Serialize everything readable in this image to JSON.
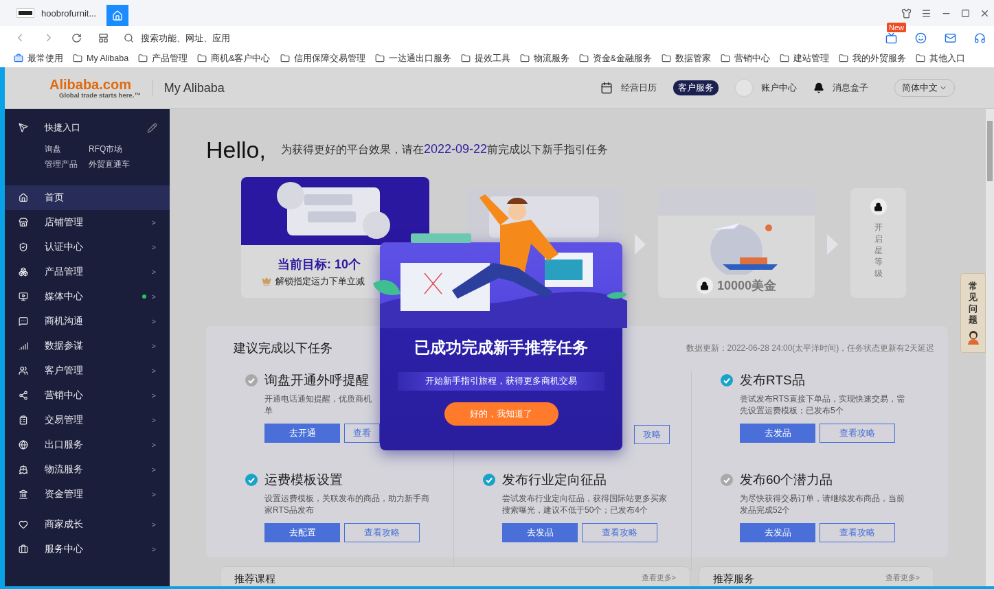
{
  "browser": {
    "tab_title": "hoobrofurnit...",
    "address_placeholder": "搜索功能、网址、应用",
    "badge": "New",
    "bookmarks": [
      {
        "label": "最常使用",
        "kind": "pinned"
      },
      {
        "label": "My Alibaba",
        "kind": "folder"
      },
      {
        "label": "产品管理",
        "kind": "folder"
      },
      {
        "label": "商机&客户中心",
        "kind": "folder"
      },
      {
        "label": "信用保障交易管理",
        "kind": "folder"
      },
      {
        "label": "一达通出口服务",
        "kind": "folder"
      },
      {
        "label": "提效工具",
        "kind": "folder"
      },
      {
        "label": "物流服务",
        "kind": "folder"
      },
      {
        "label": "资金&金融服务",
        "kind": "folder"
      },
      {
        "label": "数据管家",
        "kind": "folder"
      },
      {
        "label": "营销中心",
        "kind": "folder"
      },
      {
        "label": "建站管理",
        "kind": "folder"
      },
      {
        "label": "我的外贸服务",
        "kind": "folder"
      },
      {
        "label": "其他入口",
        "kind": "folder"
      }
    ]
  },
  "header": {
    "logo_text": "Alibaba.com",
    "logo_tagline": "Global trade starts here.™",
    "title": "My Alibaba",
    "nav": [
      {
        "label": "经营日历",
        "kind": "calendar"
      },
      {
        "label": "客户服务",
        "kind": "pill"
      },
      {
        "label": "账户中心",
        "kind": "avatar"
      },
      {
        "label": "消息盒子",
        "kind": "bell"
      }
    ],
    "language": "简体中文"
  },
  "sidebar": {
    "quick": {
      "title": "快捷入口",
      "links": [
        "询盘",
        "RFQ市场",
        "管理产品",
        "外贸直通车"
      ]
    },
    "menu_groups": [
      [
        {
          "label": "首页",
          "selected": true
        },
        {
          "label": "店铺管理",
          "selected": false,
          "chevron": ">"
        },
        {
          "label": "认证中心",
          "selected": false,
          "chevron": ">"
        },
        {
          "label": "产品管理",
          "selected": false,
          "chevron": ">"
        },
        {
          "label": "媒体中心",
          "selected": false,
          "chevron": ">",
          "color": "#22c55e"
        },
        {
          "label": "商机沟通",
          "selected": false,
          "chevron": ">"
        },
        {
          "label": "数据参谋",
          "selected": false,
          "chevron": ">"
        },
        {
          "label": "客户管理",
          "selected": false,
          "chevron": ">"
        },
        {
          "label": "营销中心",
          "selected": false,
          "chevron": ">"
        },
        {
          "label": "交易管理",
          "selected": false,
          "chevron": ">"
        },
        {
          "label": "出口服务",
          "selected": false,
          "chevron": ">"
        },
        {
          "label": "物流服务",
          "selected": false,
          "chevron": ">"
        },
        {
          "label": "资金管理",
          "selected": false,
          "chevron": ">"
        }
      ],
      [
        {
          "label": "商家成长",
          "selected": false,
          "chevron": ">"
        },
        {
          "label": "服务中心",
          "selected": false,
          "chevron": ">"
        }
      ]
    ]
  },
  "main": {
    "hello": "Hello,",
    "intro_before": "为获得更好的平台效果，请在",
    "intro_date": "2022-09-22",
    "intro_after": "前完成以下新手指引任务",
    "milestones": [
      {
        "kind": "chat",
        "title": "当前目标: 10个",
        "subtitle": "解锁指定运力下单立减",
        "selected": true
      },
      {
        "kind": "chart",
        "selected": false
      },
      {
        "kind": "shipping",
        "title": "10000美金",
        "selected": false,
        "locked": true
      },
      {
        "kind": "star",
        "title": "开启星等级",
        "selected": false,
        "locked": true
      }
    ],
    "tasks": {
      "title": "建议完成以下任务",
      "update_note": "数据更新：2022-06-28 24:00(太平洋时间)，任务状态更新有2天延迟",
      "items": [
        {
          "kind": "partial",
          "title": "询盘开通外呼提醒",
          "done": false,
          "description": "开通电话通知提醒，优质商机",
          "description_tail": "单",
          "primary": "去开通",
          "secondary": "查看"
        },
        {
          "kind": "covered",
          "secondary": "攻略"
        },
        {
          "kind": "task",
          "title": "发布RTS品",
          "done": true,
          "description": "尝试发布RTS直接下单品，实现快速交易，需先设置运费模板；已发布5个",
          "primary": "去发品",
          "secondary": "查看攻略"
        },
        {
          "kind": "task",
          "title": "运费模板设置",
          "done": true,
          "description": "设置运费模板，关联发布的商品，助力新手商家RTS品发布",
          "primary": "去配置",
          "secondary": "查看攻略"
        },
        {
          "kind": "task",
          "title": "发布行业定向征品",
          "done": true,
          "description": "尝试发布行业定向征品，获得国际站更多买家搜索曝光，建议不低于50个；已发布4个",
          "primary": "去发品",
          "secondary": "查看攻略"
        },
        {
          "kind": "task",
          "title": "发布60个潜力品",
          "done": false,
          "description": "为尽快获得交易订单，请继续发布商品，当前发品完成52个",
          "primary": "去发品",
          "secondary": "查看攻略"
        }
      ]
    },
    "recommend": [
      {
        "title": "推荐课程",
        "more": "查看更多>"
      },
      {
        "title": "推荐服务",
        "more": "查看更多>"
      }
    ],
    "faq": "常见问题"
  },
  "modal": {
    "title": "已成功完成新手推荐任务",
    "banner": "开始新手指引旅程，获得更多商机交易",
    "button": "好的，我知道了"
  }
}
